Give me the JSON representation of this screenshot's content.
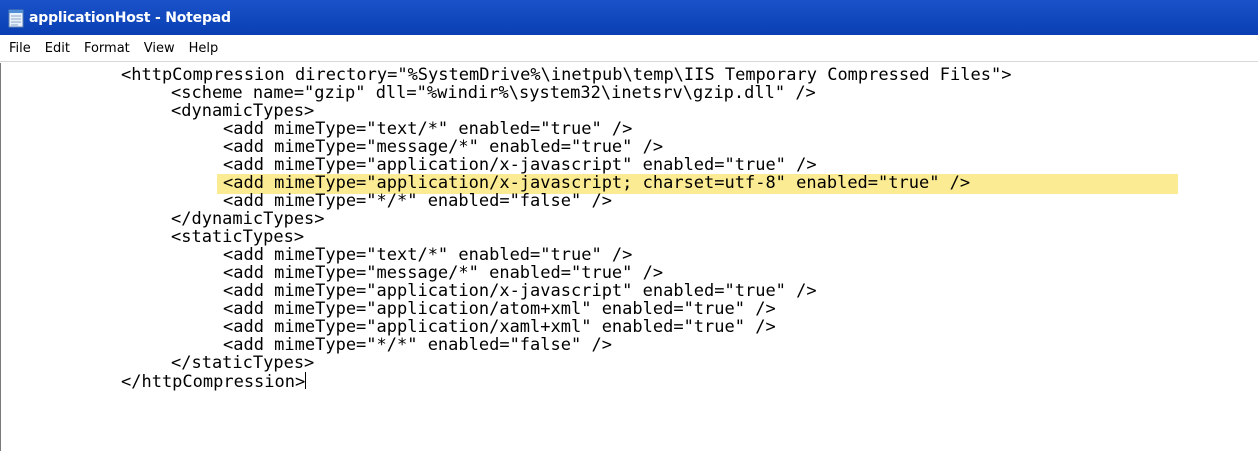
{
  "window": {
    "title": "applicationHost - Notepad",
    "icon": "notepad-icon"
  },
  "menu": {
    "items": [
      "File",
      "Edit",
      "Format",
      "View",
      "Help"
    ]
  },
  "colors": {
    "titlebar": "#0a3fb3",
    "highlight": "#fbeb93"
  },
  "document": {
    "lines": [
      "<httpCompression directory=\"%SystemDrive%\\inetpub\\temp\\IIS Temporary Compressed Files\">",
      "<scheme name=\"gzip\" dll=\"%windir%\\system32\\inetsrv\\gzip.dll\" />",
      "<dynamicTypes>",
      "<add mimeType=\"text/*\" enabled=\"true\" />",
      "<add mimeType=\"message/*\" enabled=\"true\" />",
      "<add mimeType=\"application/x-javascript\" enabled=\"true\" />",
      "<add mimeType=\"application/x-javascript; charset=utf-8\" enabled=\"true\" />",
      "<add mimeType=\"*/*\" enabled=\"false\" />",
      "</dynamicTypes>",
      "<staticTypes>",
      "<add mimeType=\"text/*\" enabled=\"true\" />",
      "<add mimeType=\"message/*\" enabled=\"true\" />",
      "<add mimeType=\"application/x-javascript\" enabled=\"true\" />",
      "<add mimeType=\"application/atom+xml\" enabled=\"true\" />",
      "<add mimeType=\"application/xaml+xml\" enabled=\"true\" />",
      "<add mimeType=\"*/*\" enabled=\"false\" />",
      "</staticTypes>",
      "</httpCompression>"
    ],
    "highlighted_line": 7
  }
}
